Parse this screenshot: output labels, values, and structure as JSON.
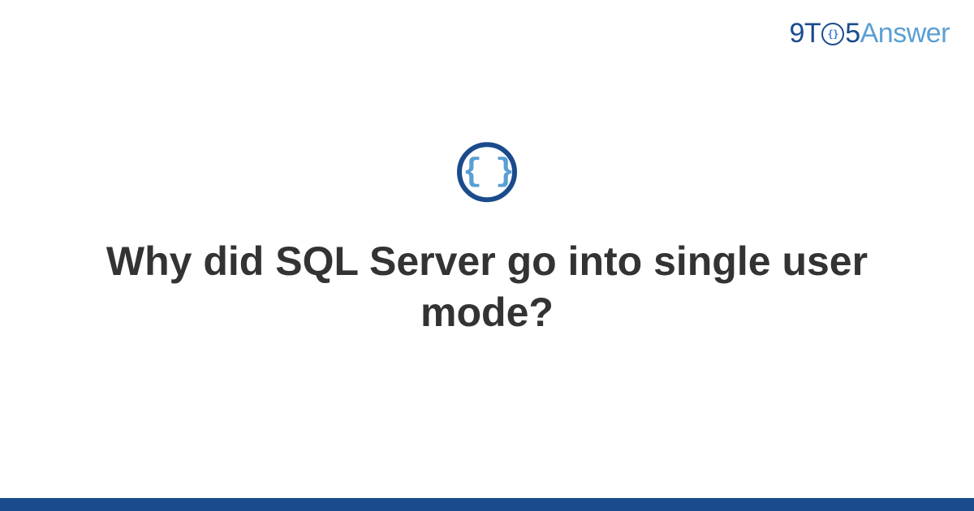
{
  "logo": {
    "part1": "9T",
    "part2": "5",
    "part3": "Answer",
    "icon_inner": "{}"
  },
  "center_icon": {
    "braces": "{ }"
  },
  "question": {
    "title": "Why did SQL Server go into single user mode?"
  },
  "colors": {
    "primary": "#1a4b8c",
    "accent": "#5a9fd4",
    "text": "#333333"
  }
}
